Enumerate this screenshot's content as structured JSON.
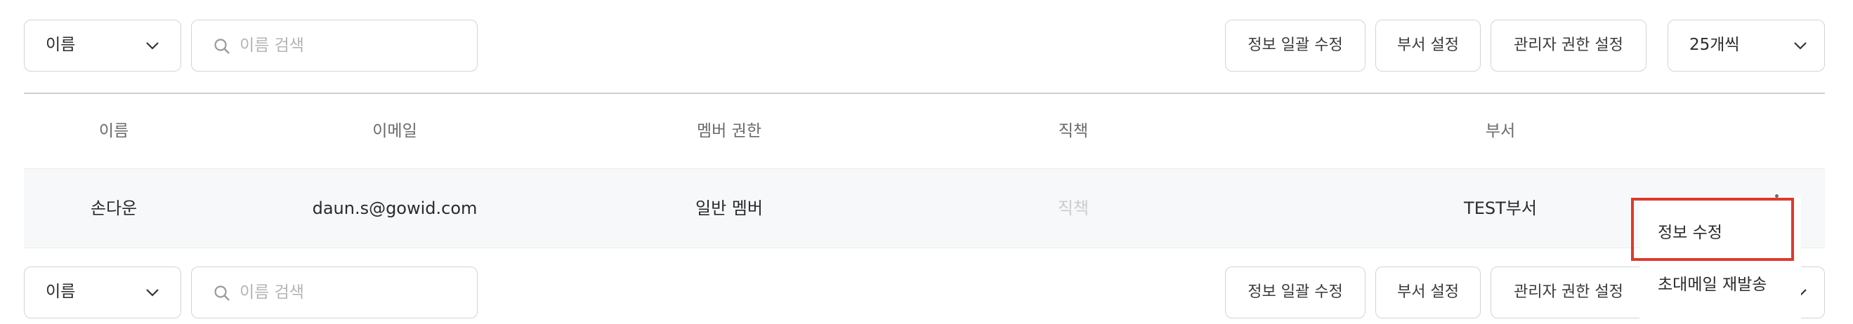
{
  "toolbar": {
    "filter_value": "이름",
    "search_placeholder": "이름 검색",
    "bulk_edit_label": "정보 일괄 수정",
    "dept_setting_label": "부서 설정",
    "admin_perm_label": "관리자 권한 설정",
    "page_size_value": "25개씩"
  },
  "table": {
    "headers": [
      "이름",
      "이메일",
      "멤버 권한",
      "직책",
      "부서"
    ],
    "rows": [
      {
        "name": "손다운",
        "email": "daun.s@gowid.com",
        "role": "일반 멤버",
        "position_placeholder": "직책",
        "department": "TEST부서"
      }
    ]
  },
  "context_menu": {
    "items": [
      "정보 수정",
      "초대메일 재발송"
    ]
  },
  "highlight_color": "#e0392b"
}
